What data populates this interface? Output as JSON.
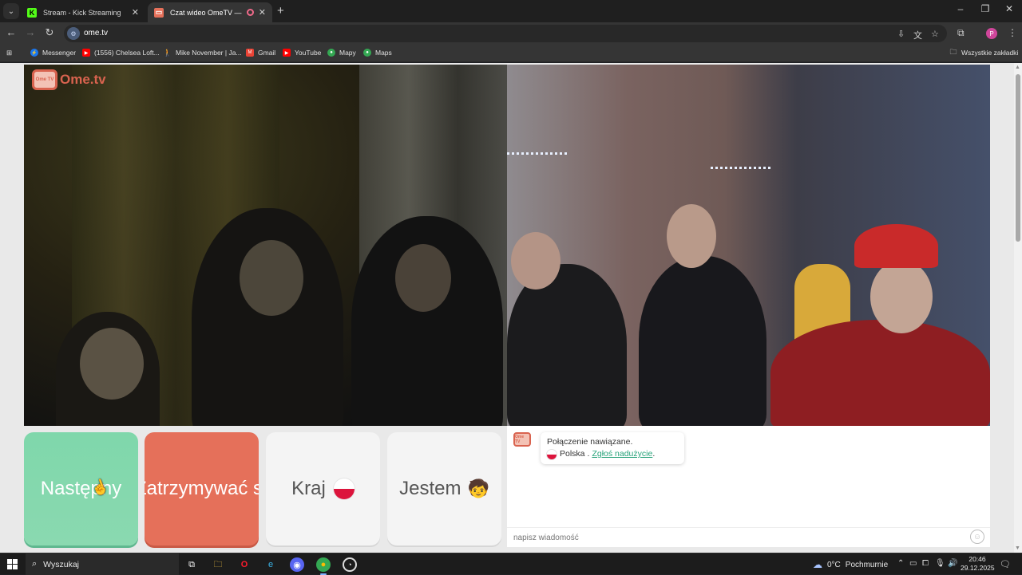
{
  "browser": {
    "tabs": [
      {
        "title": "Stream - Kick Streaming",
        "favicon": "kick-icon",
        "active": false
      },
      {
        "title": "Czat wideo OmeTV — alter",
        "favicon": "ometv-icon",
        "active": true
      }
    ],
    "url": "ome.tv",
    "bookmarks": [
      {
        "label": "Messenger",
        "icon": "messenger-icon"
      },
      {
        "label": "(1556) Chelsea Loft...",
        "icon": "youtube-icon"
      },
      {
        "label": "Mike November | Ja...",
        "icon": "person-icon"
      },
      {
        "label": "Gmail",
        "icon": "gmail-icon"
      },
      {
        "label": "YouTube",
        "icon": "youtube-icon"
      },
      {
        "label": "Mapy",
        "icon": "maps-icon"
      },
      {
        "label": "Maps",
        "icon": "maps-icon"
      }
    ],
    "all_bookmarks": "Wszystkie zakładki",
    "profile_initial": "P"
  },
  "ometv": {
    "logo_badge": "Ome TV",
    "logo_text": "Ome.tv",
    "buttons": {
      "next": "Następny",
      "stop": "Zatrzymywać się",
      "country": "Kraj",
      "gender": "Jestem",
      "gender_emoji": "🧒"
    },
    "chat": {
      "status": "Połączenie nawiązane.",
      "country": "Polska",
      "separator": ".",
      "report_link": "Zgłoś nadużycie",
      "end_dot": ".",
      "placeholder": "napisz wiadomość"
    }
  },
  "taskbar": {
    "search_label": "Wyszukaj",
    "weather_temp": "0°C",
    "weather_desc": "Pochmurnie",
    "time": "20:46",
    "date": "29.12.2025"
  },
  "colors": {
    "next": "#7fd7ab",
    "stop": "#e5705a",
    "brand": "#d9634f",
    "link": "#27a37a"
  }
}
